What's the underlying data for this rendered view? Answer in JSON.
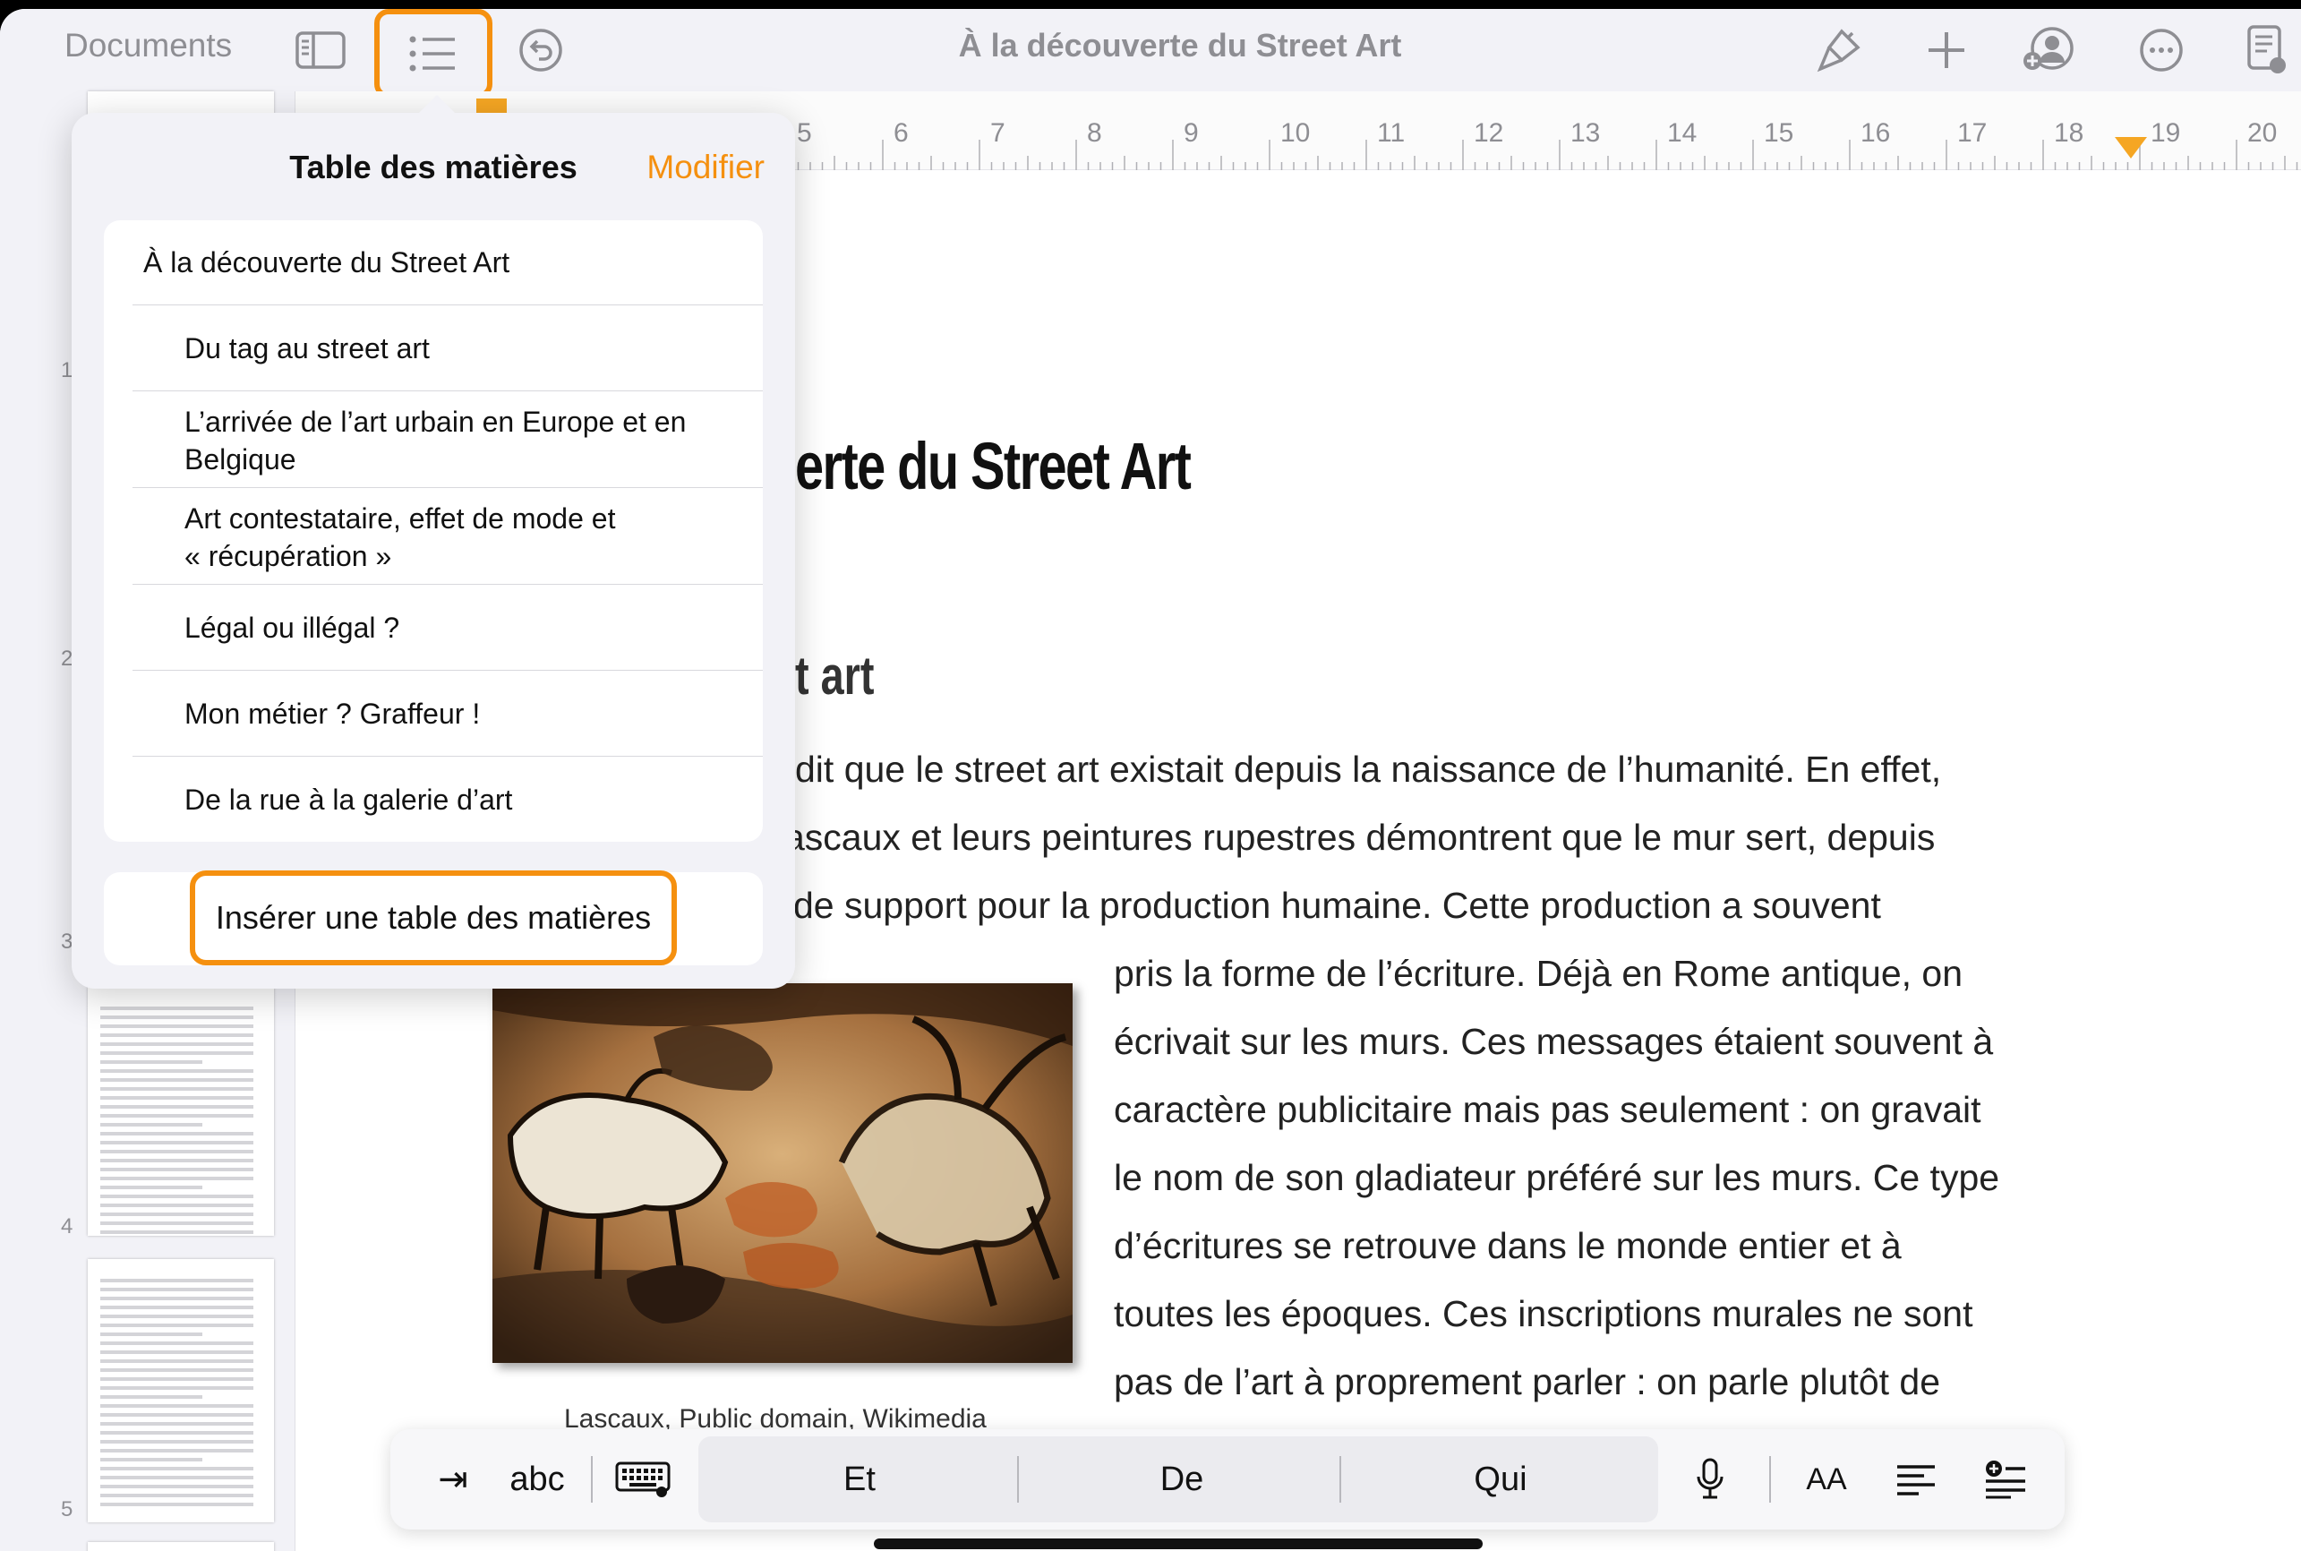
{
  "toolbar": {
    "documents_label": "Documents",
    "title": "À la découverte du Street Art",
    "icons": [
      "sidebar-icon",
      "list-icon",
      "undo-icon",
      "paintbrush-icon",
      "plus-icon",
      "collaborate-icon",
      "more-icon",
      "document-icon"
    ]
  },
  "ruler": {
    "numbers": [
      "5",
      "6",
      "7",
      "8",
      "9",
      "10",
      "11",
      "12",
      "13",
      "14",
      "15",
      "16",
      "17",
      "18",
      "19",
      "20"
    ]
  },
  "sidebar": {
    "page_numbers": [
      "1",
      "2",
      "3",
      "4",
      "5"
    ]
  },
  "popover": {
    "title": "Table des matières",
    "edit_label": "Modifier",
    "items": [
      "À la découverte du Street Art",
      "Du tag au street art",
      "L’arrivée de l’art urbain en Europe et en\nBelgique",
      "Art contestataire, effet de mode et\n« récupération »",
      "Légal ou illégal ?",
      "Mon métier ? Graffeur !",
      "De la rue à la galerie d’art"
    ],
    "insert_label": "Insérer une table des matières"
  },
  "document": {
    "heading1_visible": "erte du Street Art",
    "heading2_visible": "t art",
    "lines": [
      "dit que le street art existait depuis la naissance de l’humanité. En effet,",
      "ascaux et leurs peintures rupestres démontrent que le mur sert, depuis",
      "de support pour la production humaine. Cette production a souvent",
      "pris la forme de l’écriture. Déjà en Rome antique, on",
      "écrivait sur les murs. Ces messages étaient souvent à",
      "caractère publicitaire mais pas seulement : on gravait",
      "le nom de son gladiateur préféré sur les murs. Ce type",
      "d’écritures se retrouve dans le monde entier et à",
      "toutes les époques. Ces inscriptions murales ne sont",
      "pas de l’art à proprement parler : on parle plutôt de"
    ],
    "caption": "Lascaux, Public domain, Wikimedia"
  },
  "keyboard_bar": {
    "tab_label": "⇥",
    "abc_label": "abc",
    "suggestions": [
      "Et",
      "De",
      "Qui"
    ],
    "aa_label": "AA"
  },
  "colors": {
    "accent": "#f5900f",
    "toolbar_bg": "#f2f2f7"
  }
}
